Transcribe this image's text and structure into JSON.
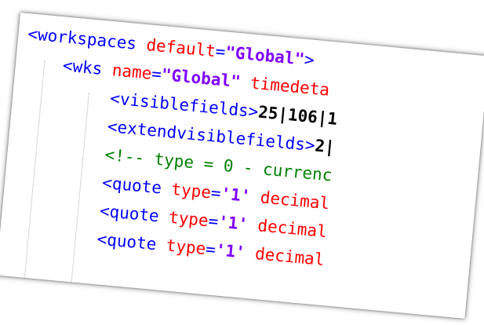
{
  "code_lines": [
    {
      "tokens": [
        {
          "text": "<workspaces ",
          "kind": "tag"
        },
        {
          "text": "default",
          "kind": "attr"
        },
        {
          "text": "=",
          "kind": "tag"
        },
        {
          "text": "\"Global\"",
          "kind": "val"
        },
        {
          "text": ">",
          "kind": "tag"
        }
      ]
    },
    {
      "tokens": [
        {
          "text": "<wks ",
          "kind": "tag"
        },
        {
          "text": "name",
          "kind": "attr"
        },
        {
          "text": "=",
          "kind": "tag"
        },
        {
          "text": "\"Global\"",
          "kind": "val"
        },
        {
          "text": " timedeta",
          "kind": "attr"
        }
      ]
    },
    {
      "tokens": [
        {
          "text": "<visiblefields>",
          "kind": "tag"
        },
        {
          "text": "25|106|1",
          "kind": "num"
        }
      ]
    },
    {
      "tokens": [
        {
          "text": "<extendvisiblefields>",
          "kind": "tag"
        },
        {
          "text": "2|",
          "kind": "num"
        }
      ]
    },
    {
      "tokens": [
        {
          "text": "<!-- type = 0 - currenc",
          "kind": "comment"
        }
      ]
    },
    {
      "tokens": [
        {
          "text": "<quote ",
          "kind": "tag"
        },
        {
          "text": "type",
          "kind": "attr"
        },
        {
          "text": "=",
          "kind": "tag"
        },
        {
          "text": "'1'",
          "kind": "val"
        },
        {
          "text": " decimal",
          "kind": "attr"
        }
      ]
    },
    {
      "tokens": [
        {
          "text": "<quote ",
          "kind": "tag"
        },
        {
          "text": "type",
          "kind": "attr"
        },
        {
          "text": "=",
          "kind": "tag"
        },
        {
          "text": "'1'",
          "kind": "val"
        },
        {
          "text": " decimal",
          "kind": "attr"
        }
      ]
    },
    {
      "tokens": [
        {
          "text": "<quote ",
          "kind": "tag"
        },
        {
          "text": "type",
          "kind": "attr"
        },
        {
          "text": "=",
          "kind": "tag"
        },
        {
          "text": "'1'",
          "kind": "val"
        },
        {
          "text": " decimal",
          "kind": "attr"
        }
      ]
    }
  ],
  "colors": {
    "tag": "#0000ff",
    "attribute": "#ff0000",
    "string_value": "#8000ff",
    "number": "#000000",
    "comment": "#008000",
    "indent_guide": "#b0b0b0",
    "background": "#ffffff"
  }
}
